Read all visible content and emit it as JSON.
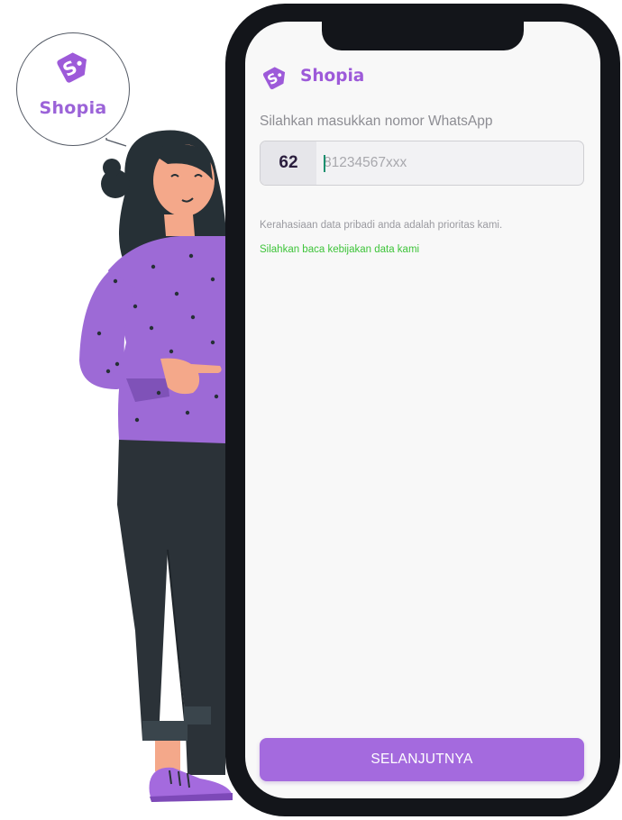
{
  "bubble": {
    "brand": "Shopia",
    "logo_icon": "price-tag-s-icon"
  },
  "header": {
    "app_name": "Shopia",
    "logo_icon": "price-tag-s-icon"
  },
  "form": {
    "prompt": "Silahkan masukkan nomor WhatsApp",
    "country_code": "62",
    "phone_value": "",
    "phone_placeholder": "81234567xxx"
  },
  "info": {
    "privacy_text": "Kerahasiaan data pribadi anda adalah prioritas kami.",
    "policy_link": "Silahkan baca kebijakan data kami"
  },
  "actions": {
    "next_label": "SELANJUTNYA"
  },
  "colors": {
    "brand_purple": "#9d5ad9",
    "button_purple": "#a46ade",
    "link_green": "#3ec43a",
    "phone_frame": "#13151a"
  }
}
